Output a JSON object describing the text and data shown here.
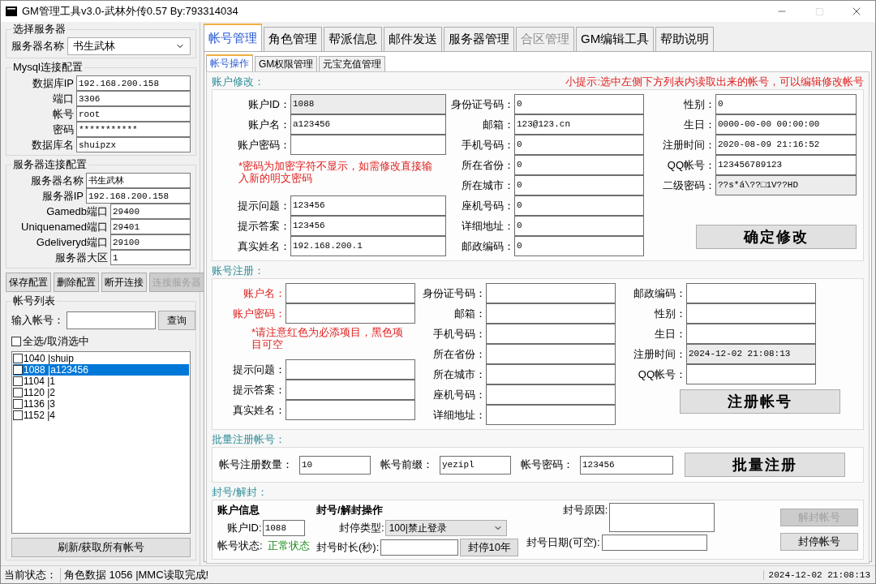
{
  "window": {
    "title": "GM管理工具v3.0-武林外传0.57 By:793314034"
  },
  "server_select": {
    "title": "选择服务器",
    "label": "服务器名称",
    "value": "书生武林"
  },
  "mysql": {
    "title": "Mysql连接配置",
    "fields": [
      {
        "label": "数据库IP",
        "value": "192.168.200.158"
      },
      {
        "label": "端口",
        "value": "3306"
      },
      {
        "label": "帐号",
        "value": "root"
      },
      {
        "label": "密码",
        "value": "***********"
      },
      {
        "label": "数据库名",
        "value": "shuipzx"
      }
    ]
  },
  "server_conn": {
    "title": "服务器连接配置",
    "fields": [
      {
        "label": "服务器名称",
        "value": "书生武林"
      },
      {
        "label": "服务器IP",
        "value": "192.168.200.158"
      },
      {
        "label": "Gamedb端口",
        "value": "29400"
      },
      {
        "label": "Uniquenamed端口",
        "value": "29401"
      },
      {
        "label": "Gdeliveryd端口",
        "value": "29100"
      },
      {
        "label": "服务器大区",
        "value": "1"
      }
    ]
  },
  "config_buttons": [
    {
      "label": "保存配置",
      "disabled": false
    },
    {
      "label": "删除配置",
      "disabled": false
    },
    {
      "label": "断开连接",
      "disabled": false
    },
    {
      "label": "连接服务器",
      "disabled": true
    }
  ],
  "account_list": {
    "title": "帐号列表",
    "search_label": "输入帐号：",
    "search_button": "查询",
    "select_all": {
      "label": "全选/取消选中",
      "checked": false
    },
    "items": [
      {
        "text": "1040 |shuip",
        "checked": false,
        "selected": false
      },
      {
        "text": "1088 |a123456",
        "checked": false,
        "selected": true
      },
      {
        "text": "1104 |1",
        "checked": false,
        "selected": false
      },
      {
        "text": "1120 |2",
        "checked": false,
        "selected": false
      },
      {
        "text": "1136 |3",
        "checked": false,
        "selected": false
      },
      {
        "text": "1152 |4",
        "checked": false,
        "selected": false
      }
    ],
    "refresh_button": "刷新/获取所有帐号"
  },
  "tabs": [
    {
      "label": "帐号管理",
      "selected": true,
      "disabled": false
    },
    {
      "label": "角色管理",
      "selected": false,
      "disabled": false
    },
    {
      "label": "帮派信息",
      "selected": false,
      "disabled": false
    },
    {
      "label": "邮件发送",
      "selected": false,
      "disabled": false
    },
    {
      "label": "服务器管理",
      "selected": false,
      "disabled": false
    },
    {
      "label": "合区管理",
      "selected": false,
      "disabled": true
    },
    {
      "label": "GM编辑工具",
      "selected": false,
      "disabled": false
    },
    {
      "label": "帮助说明",
      "selected": false,
      "disabled": false
    }
  ],
  "subtabs": [
    {
      "label": "帐号操作",
      "selected": true
    },
    {
      "label": "GM权限管理",
      "selected": false
    },
    {
      "label": "元宝充值管理",
      "selected": false
    }
  ],
  "modify": {
    "title": "账户修改：",
    "hint": "小提示:选中左侧下方列表内读取出来的帐号，可以编辑修改帐号",
    "col1_top": [
      {
        "label": "账户ID：",
        "value": "1088",
        "readonly": true
      },
      {
        "label": "账户名：",
        "value": "a123456",
        "readonly": false
      },
      {
        "label": "账户密码：",
        "readonly": false
      }
    ],
    "note": "*密码为加密字符不显示，如需修改直接输入新的明文密码",
    "col1_bottom": [
      {
        "label": "提示问题：",
        "value": "123456",
        "readonly": false
      },
      {
        "label": "提示答案：",
        "value": "123456",
        "readonly": false
      },
      {
        "label": "真实姓名：",
        "value": "192.168.200.1",
        "readonly": false
      }
    ],
    "col2": [
      {
        "label": "身份证号码：",
        "value": "0",
        "readonly": false
      },
      {
        "label": "邮箱：",
        "value": "123@123.cn",
        "readonly": false
      },
      {
        "label": "手机号码：",
        "value": "0",
        "readonly": false
      },
      {
        "label": "所在省份：",
        "value": "0",
        "readonly": false
      },
      {
        "label": "所在城市：",
        "value": "0",
        "readonly": false
      },
      {
        "label": "座机号码：",
        "value": "0",
        "readonly": false
      },
      {
        "label": "详细地址：",
        "value": "0",
        "readonly": false
      },
      {
        "label": "邮政编码：",
        "value": "0",
        "readonly": false
      }
    ],
    "col3": [
      {
        "label": "性别：",
        "value": "0",
        "readonly": false
      },
      {
        "label": "生日：",
        "value": "0000-00-00 00:00:00",
        "readonly": false
      },
      {
        "label": "注册时间：",
        "value": "2020-08-09 21:16:52",
        "readonly": false
      },
      {
        "label": "QQ帐号：",
        "value": "123456789123",
        "readonly": false
      },
      {
        "label": "二级密码：",
        "value": "??s*á\\??□1V??HD",
        "readonly": true
      }
    ],
    "submit": "确定修改"
  },
  "register": {
    "title": "账号注册：",
    "col1_top": [
      {
        "label": "账户名：",
        "required": true,
        "readonly": false
      },
      {
        "label": "账户密码：",
        "required": true,
        "readonly": false
      }
    ],
    "note": "*请注意红色为必添项目，黑色项目可空",
    "col1_bottom": [
      {
        "label": "提示问题：",
        "required": false,
        "readonly": false
      },
      {
        "label": "提示答案：",
        "required": false,
        "readonly": false
      },
      {
        "label": "真实姓名：",
        "required": false,
        "readonly": false
      }
    ],
    "col2": [
      {
        "label": "身份证号码：",
        "required": false,
        "readonly": false
      },
      {
        "label": "邮箱：",
        "required": false,
        "readonly": false
      },
      {
        "label": "手机号码：",
        "required": false,
        "readonly": false
      },
      {
        "label": "所在省份：",
        "required": false,
        "readonly": false
      },
      {
        "label": "所在城市：",
        "required": false,
        "readonly": false
      },
      {
        "label": "座机号码：",
        "required": false,
        "readonly": false
      },
      {
        "label": "详细地址：",
        "required": false,
        "readonly": false
      }
    ],
    "col3": [
      {
        "label": "邮政编码：",
        "required": false,
        "readonly": false
      },
      {
        "label": "性别：",
        "required": false,
        "readonly": false
      },
      {
        "label": "生日：",
        "required": false,
        "readonly": false
      },
      {
        "label": "注册时间：",
        "value": "2024-12-02 21:08:13",
        "required": false,
        "readonly": true
      },
      {
        "label": "QQ帐号：",
        "required": false,
        "readonly": false
      }
    ],
    "submit": "注册帐号"
  },
  "batch": {
    "title": "批量注册帐号：",
    "fields": [
      {
        "label": "帐号注册数量：",
        "value": "10"
      },
      {
        "label": "帐号前缀：",
        "value": "yezipl"
      },
      {
        "label": "帐号密码：",
        "value": "123456"
      }
    ],
    "submit": "批量注册"
  },
  "ban": {
    "title": "封号/解封：",
    "info_title": "账户信息",
    "id_label": "账户ID:",
    "id_value": "1088",
    "status_label": "帐号状态:",
    "status": "正常状态",
    "ops_title": "封号/解封操作",
    "type_label": "封停类型:",
    "type_value": "100|禁止登录",
    "duration_label": "封号时长(秒):",
    "ten_year_button": "封停10年",
    "reason_label": "封号原因:",
    "date_label": "封号日期(可空):",
    "buttons": [
      {
        "label": "解封帐号",
        "disabled": true
      },
      {
        "label": "封停帐号",
        "disabled": false
      }
    ]
  },
  "status_bar": {
    "label": "当前状态：",
    "message": "角色数据 1056 |MMC读取完成!",
    "time": "2024-12-02 21:08:13"
  }
}
